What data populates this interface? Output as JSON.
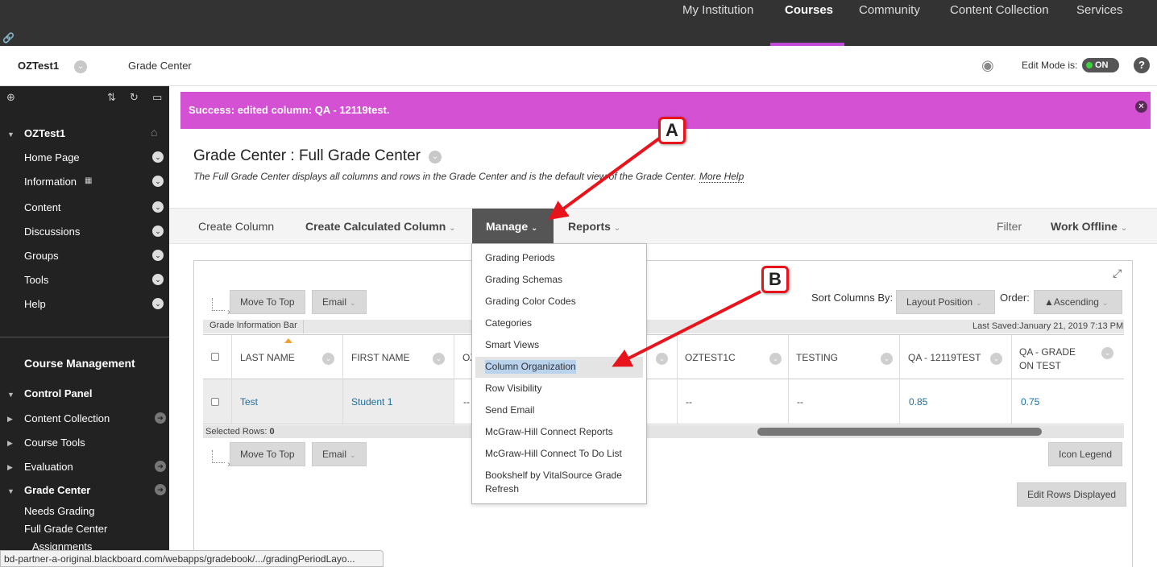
{
  "top_nav": {
    "items": [
      "My Institution",
      "Courses",
      "Community",
      "Content Collection",
      "Services"
    ],
    "active": "Courses"
  },
  "breadcrumb": {
    "course": "OZTest1",
    "page": "Grade Center",
    "edit_mode_label": "Edit Mode is:",
    "edit_mode_value": "ON",
    "help": "?"
  },
  "sidebar": {
    "course_title": "OZTest1",
    "items": [
      "Home Page",
      "Information",
      "Content",
      "Discussions",
      "Groups",
      "Tools",
      "Help"
    ],
    "course_management": "Course Management",
    "control_panel": "Control Panel",
    "cp_items": [
      "Content Collection",
      "Course Tools",
      "Evaluation",
      "Grade Center"
    ],
    "gc_items": [
      "Needs Grading",
      "Full Grade Center",
      "Assignments"
    ]
  },
  "banner": {
    "text": "Success: edited column: QA - 12119test."
  },
  "page": {
    "title": "Grade Center : Full Grade Center",
    "description": "The Full Grade Center displays all columns and rows in the Grade Center and is the default view of the Grade Center.",
    "more_help": "More Help"
  },
  "actionbar": {
    "create_column": "Create Column",
    "create_calculated": "Create Calculated Column",
    "manage": "Manage",
    "reports": "Reports",
    "filter": "Filter",
    "work_offline": "Work Offline"
  },
  "grid": {
    "move_to_top": "Move To Top",
    "email": "Email",
    "sort_columns_by": "Sort Columns By:",
    "layout_position": "Layout Position",
    "order": "Order:",
    "ascending": "▲Ascending",
    "info_bar": "Grade Information Bar",
    "last_saved": "Last Saved:January 21, 2019 7:13 PM",
    "headers": [
      "LAST NAME",
      "FIRST NAME",
      "OZ",
      "OZTEST1C",
      "TESTING",
      "QA - 12119TEST",
      "QA - GRADE ON TEST"
    ],
    "row": {
      "last_name": "Test",
      "first_name": "Student 1",
      "oz": "--",
      "oztest1c": "--",
      "testing": "--",
      "qa_12119": "0.85",
      "qa_grade": "0.75"
    },
    "selected_rows_label": "Selected Rows:",
    "selected_rows_count": "0",
    "icon_legend": "Icon Legend",
    "edit_rows": "Edit Rows Displayed"
  },
  "manage_menu": {
    "items": [
      "Grading Periods",
      "Grading Schemas",
      "Grading Color Codes",
      "Categories",
      "Smart Views",
      "Column Organization",
      "Row Visibility",
      "Send Email",
      "McGraw-Hill Connect Reports",
      "McGraw-Hill Connect To Do List",
      "Bookshelf by VitalSource Grade Refresh"
    ],
    "selected": "Column Organization"
  },
  "callouts": [
    "A",
    "B"
  ],
  "status_url": "bd-partner-a-original.blackboard.com/webapps/gradebook/.../gradingPeriodLayo...",
  "colors": {
    "banner": "#d451d4",
    "nav_active_underline": "#c04bd8",
    "callout_border": "#e8141c",
    "link": "#1b6fa0"
  }
}
